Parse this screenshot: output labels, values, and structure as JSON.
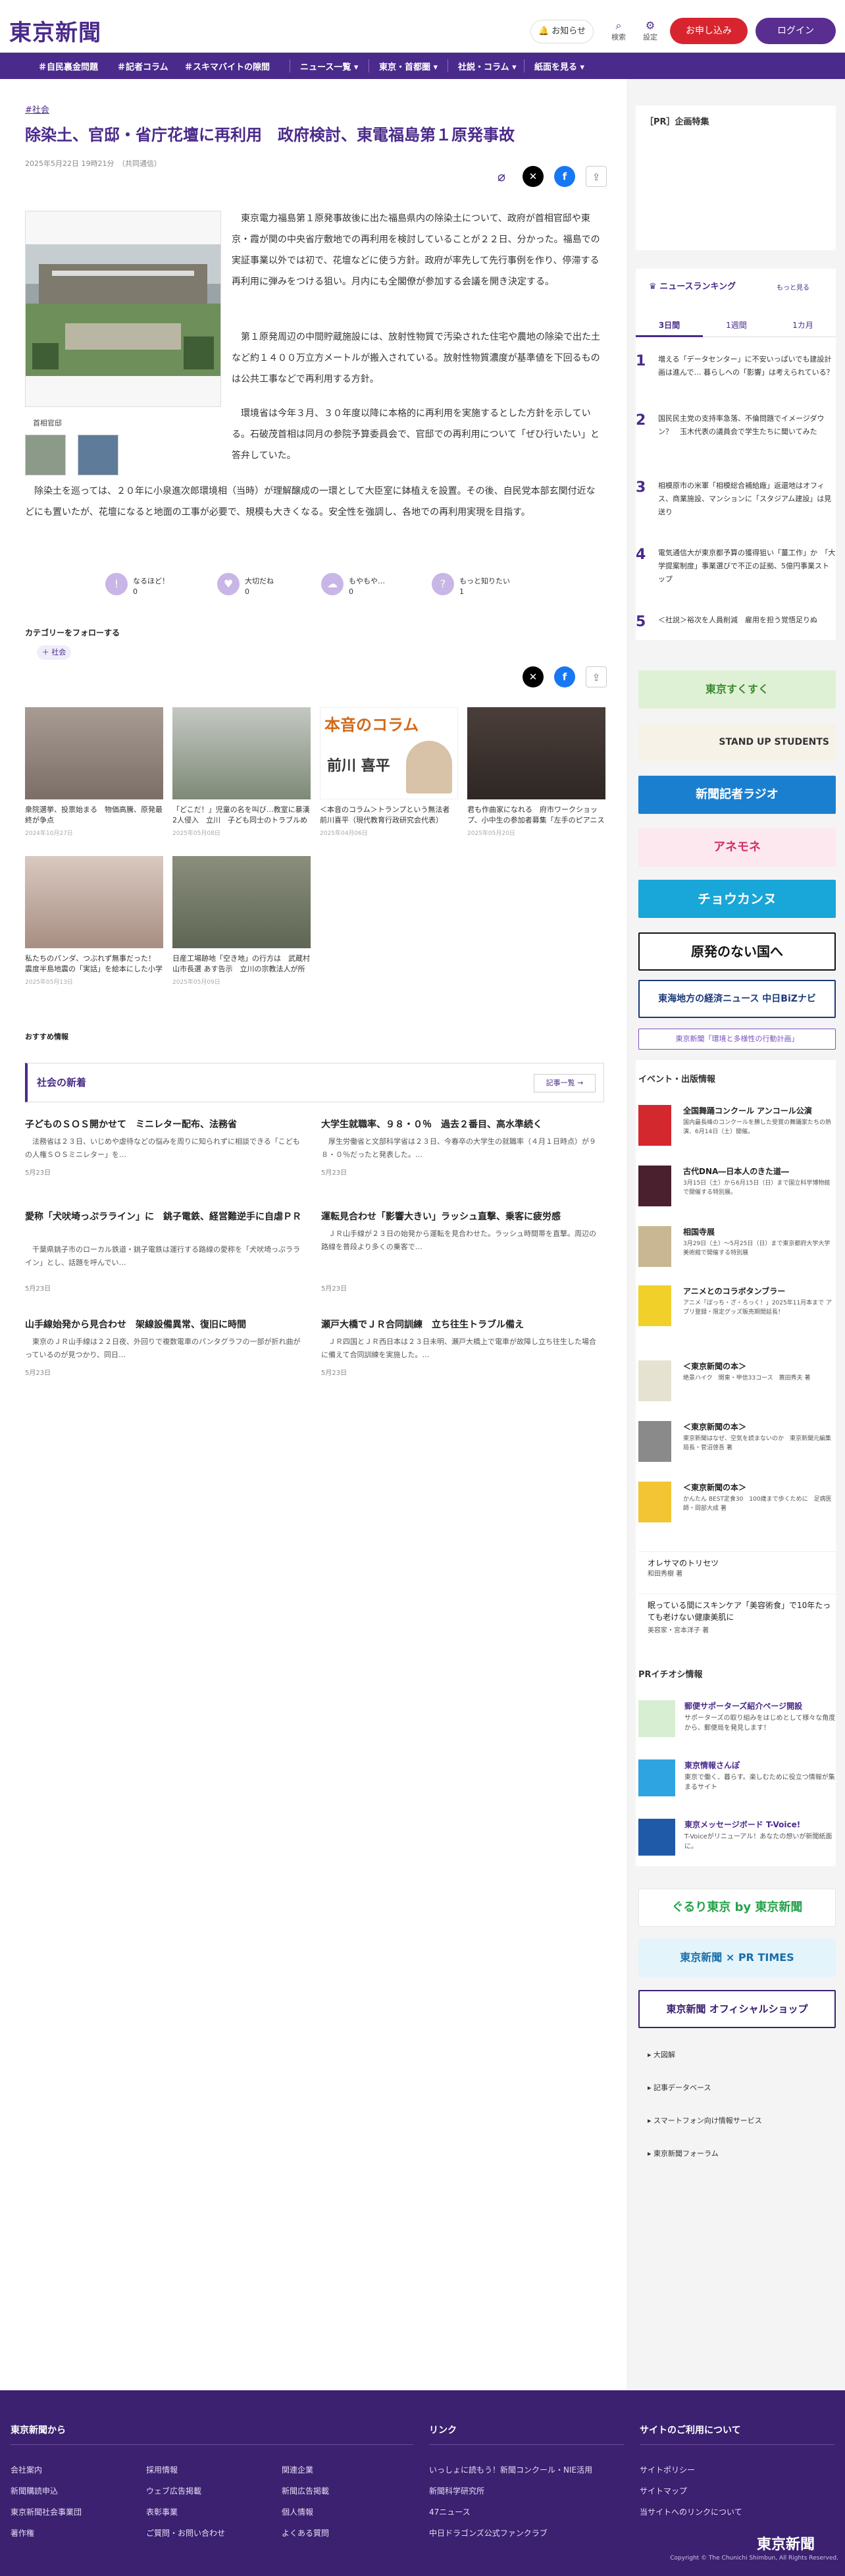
{
  "header": {
    "logo": "東京新聞",
    "notify": "お知らせ",
    "search_label": "検索",
    "settings_label": "設定",
    "apply": "お申し込み",
    "login": "ログイン"
  },
  "nav": [
    "＃自民裏金問題",
    "＃記者コラム",
    "＃スキマバイトの隙間",
    "ニュース一覧 ▾",
    "東京・首都圏 ▾",
    "社説・コラム ▾",
    "紙面を見る ▾"
  ],
  "article": {
    "tag": "#社会",
    "title": "除染土、官邸・省庁花壇に再利用　政府検討、東電福島第１原発事故",
    "date": "2025年5月22日 19時21分　（共同通信）",
    "photo_caption": "首相官邸",
    "paragraphs": [
      "東京電力福島第１原発事故後に出た福島県内の除染土について、政府が首相官邸や東京・霞が関の中央省庁敷地での再利用を検討していることが２２日、分かった。福島での実証事業以外では初で、花壇などに使う方針。政府が率先して先行事例を作り、停滞する再利用に弾みをつける狙い。月内にも全閣僚が参加する会議を開き決定する。",
      "第１原発周辺の中間貯蔵施設には、放射性物質で汚染された住宅や農地の除染で出た土など約１４００万立方メートルが搬入されている。放射性物質濃度が基準値を下回るものは公共工事などで再利用する方針。",
      "環境省は今年３月、３０年度以降に本格的に再利用を実施するとした方針を示している。石破茂首相は同月の参院予算委員会で、官邸での再利用について「ぜひ行いたい」と答弁していた。",
      "除染土を巡っては、２０年に小泉進次郎環境相（当時）が理解醸成の一環として大臣室に鉢植えを設置。その後、自民党本部玄関付近などにも置いたが、花壇になると地面の工事が必要で、規模も大きくなる。安全性を強調し、各地での再利用実現を目指す。"
    ],
    "reactions": [
      {
        "label": "なるほど！",
        "count": "0"
      },
      {
        "label": "大切だね",
        "count": "0"
      },
      {
        "label": "もやもや…",
        "count": "0"
      },
      {
        "label": "もっと知りたい",
        "count": "1"
      }
    ]
  },
  "follow": {
    "heading": "カテゴリーをフォローする",
    "pill": "＋ 社会"
  },
  "related": [
    {
      "title": "衆院選挙、投票始まる　物価高騰、原発最終が争点",
      "date": "2024年10月27日"
    },
    {
      "title": "「どこだ！」児童の名を叫び…教室に暴漢2人侵入　立川　子ども同士のトラブルめぐり保護…",
      "date": "2025年05月08日"
    },
    {
      "title": "＜本音のコラム＞トランプという無法者　前川喜平（現代教育行政研究会代表）",
      "date": "2025年04月06日"
    },
    {
      "title": "君も作曲家になれる　府市ワークショップ、小中生の参加者募集「左手のピアニスト」智内…",
      "date": "2025年05月20日"
    },
    {
      "title": "私たちのパンダ、つぶれず無事だった！　震度半島地震の「実話」を絵本にした小学生　作…",
      "date": "2025年05月13日"
    },
    {
      "title": "日産工場跡地「空き地」の行方は　武蔵村山市長選 あす告示　立川の宗教法人が所有　市の…",
      "date": "2025年05月09日"
    }
  ],
  "column_banner": {
    "title": "本音のコラム",
    "name": "前川 喜平"
  },
  "recs": "おすすめ情報",
  "shinchaku": {
    "heading": "社会の新着",
    "more": "記事一覧"
  },
  "news": [
    {
      "title": "子どものＳＯＳ開かせて　ミニレター配布、法務省",
      "summary": "法務省は２３日、いじめや虐待などの悩みを周りに知られずに相談できる「こどもの人権ＳＯＳミニレター」を…",
      "date": "5月23日"
    },
    {
      "title": "大学生就職率、９８・０％　過去２番目、高水準続く",
      "summary": "厚生労働省と文部科学省は２３日、今春卒の大学生の就職率（４月１日時点）が９８・０％だったと発表した。…",
      "date": "5月23日"
    },
    {
      "title": "愛称「犬吠埼っぷラライン」に　銚子電鉄、経営難逆手に自虐ＰＲ",
      "summary": "千葉県銚子市のローカル鉄道・銚子電鉄は運行する路線の愛称を「犬吠埼っぷラライン」とし、話題を呼んでい…",
      "date": "5月23日"
    },
    {
      "title": "運転見合わせ「影響大きい」ラッシュ直撃、乗客に疲労感",
      "summary": "ＪＲ山手線が２３日の始発から運転を見合わせた。ラッシュ時間帯を直撃。周辺の路線を普段より多くの乗客で…",
      "date": "5月23日"
    },
    {
      "title": "山手線始発から見合わせ　架線設備異常、復旧に時間",
      "summary": "東京のＪＲ山手線は２２日夜、外回りで複数電車のパンタグラフの一部が折れ曲がっているのが見つかり、同日…",
      "date": "5月23日"
    },
    {
      "title": "瀬戸大橋でＪＲ合同訓練　立ち往生トラブル備え",
      "summary": "ＪＲ四国とＪＲ西日本は２３日未明、瀬戸大橋上で電車が故障し立ち往生した場合に備えて合同訓練を実施した。…",
      "date": "5月23日"
    }
  ],
  "sidebar": {
    "pr_heading": "［PR］企画特集",
    "ranking_heading": "ニュースランキング",
    "ranking_more": "もっと見る",
    "ranking_tabs": [
      "3日間",
      "1週間",
      "1カ月"
    ],
    "ranking": [
      "増える「データセンター」に不安いっぱいでも建設計画は進んで… 暮らしへの「影響」は考えられている？",
      "国民民主党の支持率急落、不倫問題でイメージダウン？　玉木代表の議員会で学生たちに聞いてみた",
      "相模原市の米軍「相模総合補給廠」返還地はオフィス、商業施設、マンションに「スタジアム建設」は見送り",
      "電気通信大が東京都予算の獲得狙い「薑工作」か　「大学提案制度」事業選びで不正の証拠、5億円事業ストップ",
      "＜社説＞裕次を人員削減　雇用を担う覚悟足りぬ"
    ],
    "banners": [
      "東京すくすく",
      "STAND UP STUDENTS",
      "新聞記者ラジオ",
      "アネモネ",
      "チョウカンヌ",
      "原発のない国へ",
      "東海地方の経済ニュース 中日BiZナビ",
      "東京新聞「環境と多様性の行動計画」"
    ],
    "events_heading": "イベント・出版情報",
    "events": [
      {
        "title": "全国舞踊コンクール アンコール公演",
        "sub": "国内最長峰のコンクールを勝した受賞の舞踊家たちの熱演、6月14日（土）開催。"
      },
      {
        "title": "古代DNA―日本人のきた道―",
        "sub": "3月15日（土）から6月15日（日）まで国立科学博物館で開催する特別展。"
      },
      {
        "title": "相国寺展",
        "sub": "3月29日（土）〜5月25日（日）まで東京都府大学大学美術館で開催する特別展"
      },
      {
        "title": "アニメとのコラボタンブラー",
        "sub": "アニメ「ぼっち・ざ・ろっく！」2025年11月本まで アプリ登録・限定グッズ販売期間延長！"
      },
      {
        "title": "＜東京新聞の本＞",
        "sub": "絶景ハイク　関東・甲信33コース　蓑田秀夫 著"
      },
      {
        "title": "＜東京新聞の本＞",
        "sub": "東京新聞はなぜ、空気を読まないのか　東京新聞元編集局長・菅沼啓吾 著"
      },
      {
        "title": "＜東京新聞の本＞",
        "sub": "かんたん BEST定食30　100歳まで歩くために　足病医師・岡部大成 著"
      },
      {
        "title": "オレサマのトリセツ",
        "sub": "和田秀樹 著"
      },
      {
        "title": "眠っている間にスキンケア「美容術食」で10年たっても老けない健康美肌に",
        "sub": "美容家・宮本洋子 著"
      }
    ],
    "pr2_heading": "PRイチオシ情報",
    "pr2": [
      {
        "title": "郵便サポーターズ紹介ページ開設",
        "sub": "サポーターズの取り組みをはじめとして様々な角度から、郵便局を発見します！"
      },
      {
        "title": "東京情報さんぽ",
        "sub": "東京で働く、暮らす。楽しむために役立つ情報が集まるサイト"
      },
      {
        "title": "東京メッセージボード T-Voice!",
        "sub": "T-Voiceがリニューアル！あなたの想いが新聞紙面に。"
      }
    ],
    "banners2": [
      "ぐるり東京 by 東京新聞",
      "東京新聞 × PR TIMES",
      "東京新聞 オフィシャルショップ"
    ],
    "links": [
      "大図解",
      "記事データベース",
      "スマートフォン向け情報サービス",
      "東京新聞フォーラム"
    ]
  },
  "footer": {
    "from": "東京新聞から",
    "links": "リンク",
    "about": "サイトのご利用について",
    "col1": [
      "会社案内",
      "新聞購読申込",
      "東京新聞社会事業団",
      "著作権"
    ],
    "col2": [
      "採用情報",
      "ウェブ広告掲載",
      "表彰事業",
      "ご質問・お問い合わせ"
    ],
    "col3": [
      "関連企業",
      "新聞広告掲載",
      "個人情報",
      "よくある質問"
    ],
    "col4": [
      "いっしょに読もう！新聞コンクール・NIE活用",
      "新聞科学研究所",
      "47ニュース",
      "中日ドラゴンズ公式ファンクラブ"
    ],
    "col5": [
      "サイトポリシー",
      "サイトマップ",
      "当サイトへのリンクについて"
    ],
    "logo": "東京新聞",
    "copyright": "Copyright © The Chunichi Shimbun, All Rights Reserved."
  }
}
